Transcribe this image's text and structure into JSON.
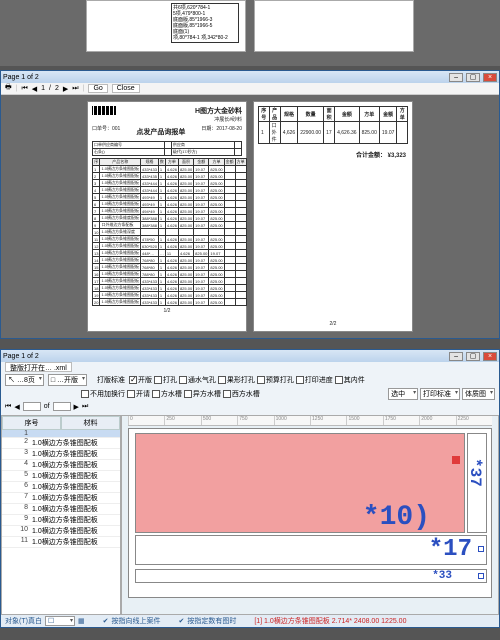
{
  "thumb_box_lines": [
    "共6项,620*784-1",
    "5项,479*800-1",
    "底面版,85*1966-3",
    "底面版,85*1966-5",
    "底面(1)",
    "项,80*784-1 项,342*80-2"
  ],
  "report": {
    "window_title": "Page 1 of 2",
    "toolbar": {
      "page_x": "1",
      "page_y": "2",
      "go": "Go",
      "close": "Close"
    },
    "brand": "H图方大金砂料",
    "brand_sub": "冲展长#砂料",
    "doc_title": "点发产品询报单",
    "order_no_label": "口单号：001",
    "date_label": "日期：2017-08-20",
    "meta_row": {
      "l1": "口单供应商编号",
      "l2": "供应商",
      "l3": "石条()",
      "l4": "级代(17/秒方)"
    },
    "cols": [
      "序",
      "产品名称",
      "规格",
      "数",
      "方单",
      "面积",
      "金额",
      "方单",
      "金额",
      "方单"
    ],
    "rows": [
      {
        "name": "1.0横边方条锥图配板",
        "spec": "433*433",
        "q": "1",
        "a": "4.626",
        "b": "825.00",
        "c": "19.07",
        "d": "825.00"
      },
      {
        "name": "1.0横边方条锥图配板",
        "spec": "433*435",
        "q": "1",
        "a": "4.626",
        "b": "825.00",
        "c": "19.07",
        "d": "825.00"
      },
      {
        "name": "1.0横边方条锥图配板",
        "spec": "433*444",
        "q": "1",
        "a": "4.626",
        "b": "825.00",
        "c": "19.07",
        "d": "825.00"
      },
      {
        "name": "1.0横边方条锥图配板",
        "spec": "433*444",
        "q": "1",
        "a": "4.626",
        "b": "825.00",
        "c": "19.07",
        "d": "825.00"
      },
      {
        "name": "1.0横边方条锥图配板",
        "spec": "493*49",
        "q": "1",
        "a": "4.626",
        "b": "825.00",
        "c": "19.07",
        "d": "825.00"
      },
      {
        "name": "1.0横边方条锥图配板",
        "spec": "493*49",
        "q": "1",
        "a": "4.626",
        "b": "825.00",
        "c": "19.07",
        "d": "825.00"
      },
      {
        "name": "1.0横边方条锥图配板",
        "spec": "494*49",
        "q": "1",
        "a": "4.626",
        "b": "825.00",
        "c": "19.07",
        "d": "825.00"
      },
      {
        "name": "1.0横边方条维度配板",
        "spec": "388*388",
        "q": "1",
        "a": "4.626",
        "b": "825.00",
        "c": "19.07",
        "d": "825.00"
      },
      {
        "name": "口外维边方条配板",
        "spec": "388*388",
        "q": "1",
        "a": "4.626",
        "b": "825.00",
        "c": "19.07",
        "d": "825.00"
      },
      {
        "name": "1.0横边方条锥深度",
        "spec": "",
        "q": "",
        "a": "",
        "b": "",
        "c": "",
        "d": ""
      },
      {
        "name": "1.0横边方条锥图配板",
        "spec": "478*50",
        "q": "1",
        "a": "4.626",
        "b": "825.00",
        "c": "19.07",
        "d": "825.00"
      },
      {
        "name": "1.0横边方条锥图配板",
        "spec": "630*520",
        "q": "1",
        "a": "4.626",
        "b": "825.00",
        "c": "19.07",
        "d": "825.00"
      },
      {
        "name": "1.0横边方条锥图配板",
        "spec": "448*… ",
        "q": "…",
        "a": "11",
        "b": "4.626",
        "c": "825.00",
        "d": "19.07"
      },
      {
        "name": "1.0横边方条锥图配板",
        "spec": "768*80",
        "q": "1",
        "a": "4.626",
        "b": "825.00",
        "c": "19.07",
        "d": "825.00"
      },
      {
        "name": "1.0横边方条锥图配板",
        "spec": "768*80",
        "q": "1",
        "a": "4.626",
        "b": "825.00",
        "c": "19.07",
        "d": "825.00"
      },
      {
        "name": "1.0横边方条锥图配板",
        "spec": "788*80",
        "q": "1",
        "a": "4.626",
        "b": "825.00",
        "c": "19.07",
        "d": "825.00"
      },
      {
        "name": "1.0横边方条锥图配板",
        "spec": "433*433",
        "q": "1",
        "a": "4.626",
        "b": "825.00",
        "c": "19.07",
        "d": "825.00"
      },
      {
        "name": "1.0横边方条锥图配板",
        "spec": "433*433",
        "q": "1",
        "a": "4.626",
        "b": "825.00",
        "c": "19.07",
        "d": "825.00"
      },
      {
        "name": "1.0横边方条锥图配板",
        "spec": "433*433",
        "q": "1",
        "a": "4.626",
        "b": "825.00",
        "c": "19.07",
        "d": "825.00"
      },
      {
        "name": "1.0横边方条锥图配板",
        "spec": "433*433",
        "q": "1",
        "a": "4.626",
        "b": "825.00",
        "c": "19.07",
        "d": "825.00"
      }
    ],
    "page1_num": "1/2",
    "summary_cols": [
      "序号",
      "产品",
      "规格",
      "数量",
      "面积",
      "金额",
      "方单",
      "金额",
      "方单"
    ],
    "summary_rows": [
      {
        "n": "1",
        "p": "口外件",
        "s": "4,626",
        "a": "22900.00",
        "b": "17",
        "c": "4,626.36",
        "d": "825.00",
        "e": "19.07"
      }
    ],
    "total_label": "合计金额：",
    "total_value": "¥3,323",
    "page2_num": "2/2"
  },
  "editor": {
    "window_title": "Page 1 of 2",
    "tab": "整版打开在… .xml",
    "btn_left1": "↖ …8页",
    "btn_left2": "□ …开版",
    "filter_grp": "打版标准",
    "chk_row1": [
      "开版",
      "打孔",
      "通水气孔",
      "果形打孔",
      "预算打孔",
      "打印进度",
      "其内件"
    ],
    "chk_row2": [
      "不用加换行",
      "开请",
      "方水槽",
      "异方水槽",
      "西方水槽"
    ],
    "btn_row2": [
      "选中",
      "打印标准",
      "体质图"
    ],
    "pager_of": "of",
    "tree_head": [
      "序号",
      "材料"
    ],
    "tree_rows": [
      {
        "n": "1",
        "t": ""
      },
      {
        "n": "2",
        "t": "1.0横边方条锥图配板"
      },
      {
        "n": "3",
        "t": "1.0横边方条锥图配板"
      },
      {
        "n": "4",
        "t": "1.0横边方条锥图配板"
      },
      {
        "n": "5",
        "t": "1.0横边方条锥图配板"
      },
      {
        "n": "6",
        "t": "1.0横边方条锥图配板"
      },
      {
        "n": "7",
        "t": "1.0横边方条锥图配板"
      },
      {
        "n": "8",
        "t": "1.0横边方条锥图配板"
      },
      {
        "n": "9",
        "t": "1.0横边方条锥图配板"
      },
      {
        "n": "10",
        "t": "1.0横边方条锥图配板"
      },
      {
        "n": "11",
        "t": "1.0横边方条锥图配板"
      }
    ],
    "canvas": {
      "t10": "*10)",
      "t17": "*17",
      "t33": "*33",
      "t49": "*37"
    },
    "ruler_marks": [
      "0",
      "250",
      "500",
      "750",
      "1000",
      "1250",
      "1500",
      "1750",
      "2000",
      "2250"
    ],
    "status": {
      "left": "对象(T)真白",
      "combo": "☐",
      "mid1": "按指向线上案件",
      "mid2": "按指定数有图时",
      "info": "[1] 1.0横边方条锥图配板 2.714* 2408.00 1225.00"
    }
  }
}
